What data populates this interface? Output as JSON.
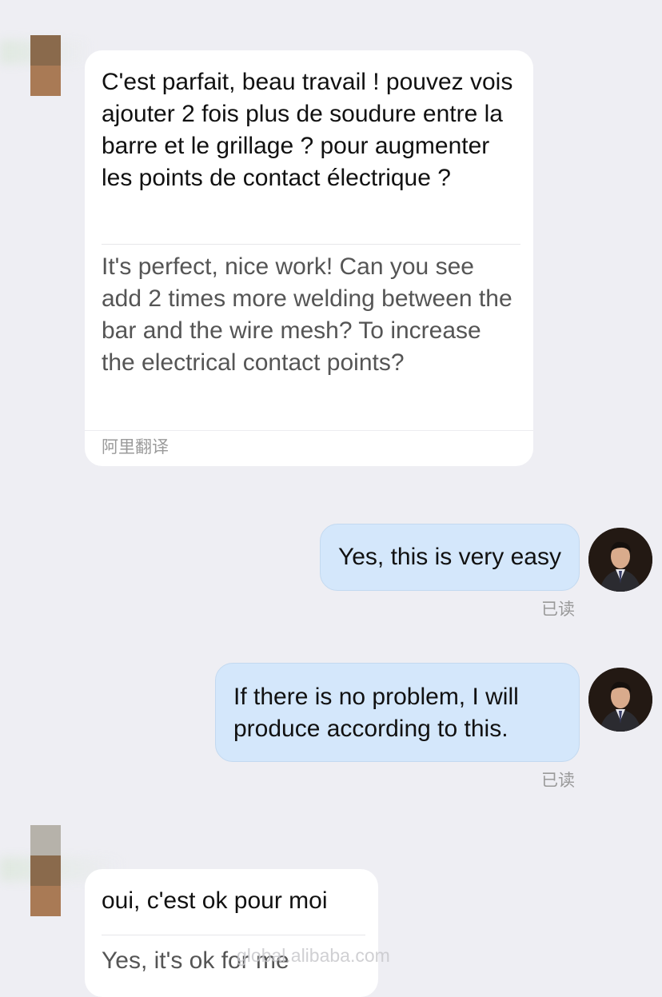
{
  "messages": [
    {
      "direction": "incoming",
      "original": "C'est parfait, beau travail ! pouvez vois ajouter 2 fois plus de soudure entre la barre et le grillage ? pour augmenter les points de contact électrique ?",
      "translation": "It's perfect, nice work! Can you see add 2 times more welding between the bar and the wire mesh? To increase the electrical contact points?",
      "translator": "阿里翻译"
    },
    {
      "direction": "outgoing",
      "text": "Yes, this is very easy",
      "status": "已读"
    },
    {
      "direction": "outgoing",
      "text": "If there is no problem, I will produce according to this.",
      "status": "已读"
    },
    {
      "direction": "incoming",
      "original": "oui, c'est ok pour moi",
      "translation": "Yes, it's ok for me"
    }
  ],
  "watermark": "global.alibaba.com",
  "icons": {
    "sender_avatar": "blurred-avatar-icon",
    "self_avatar": "user-photo-avatar"
  },
  "colors": {
    "background": "#eeeef3",
    "incoming_bubble": "#ffffff",
    "outgoing_bubble": "#d4e7fb",
    "meta_text": "#999999"
  }
}
